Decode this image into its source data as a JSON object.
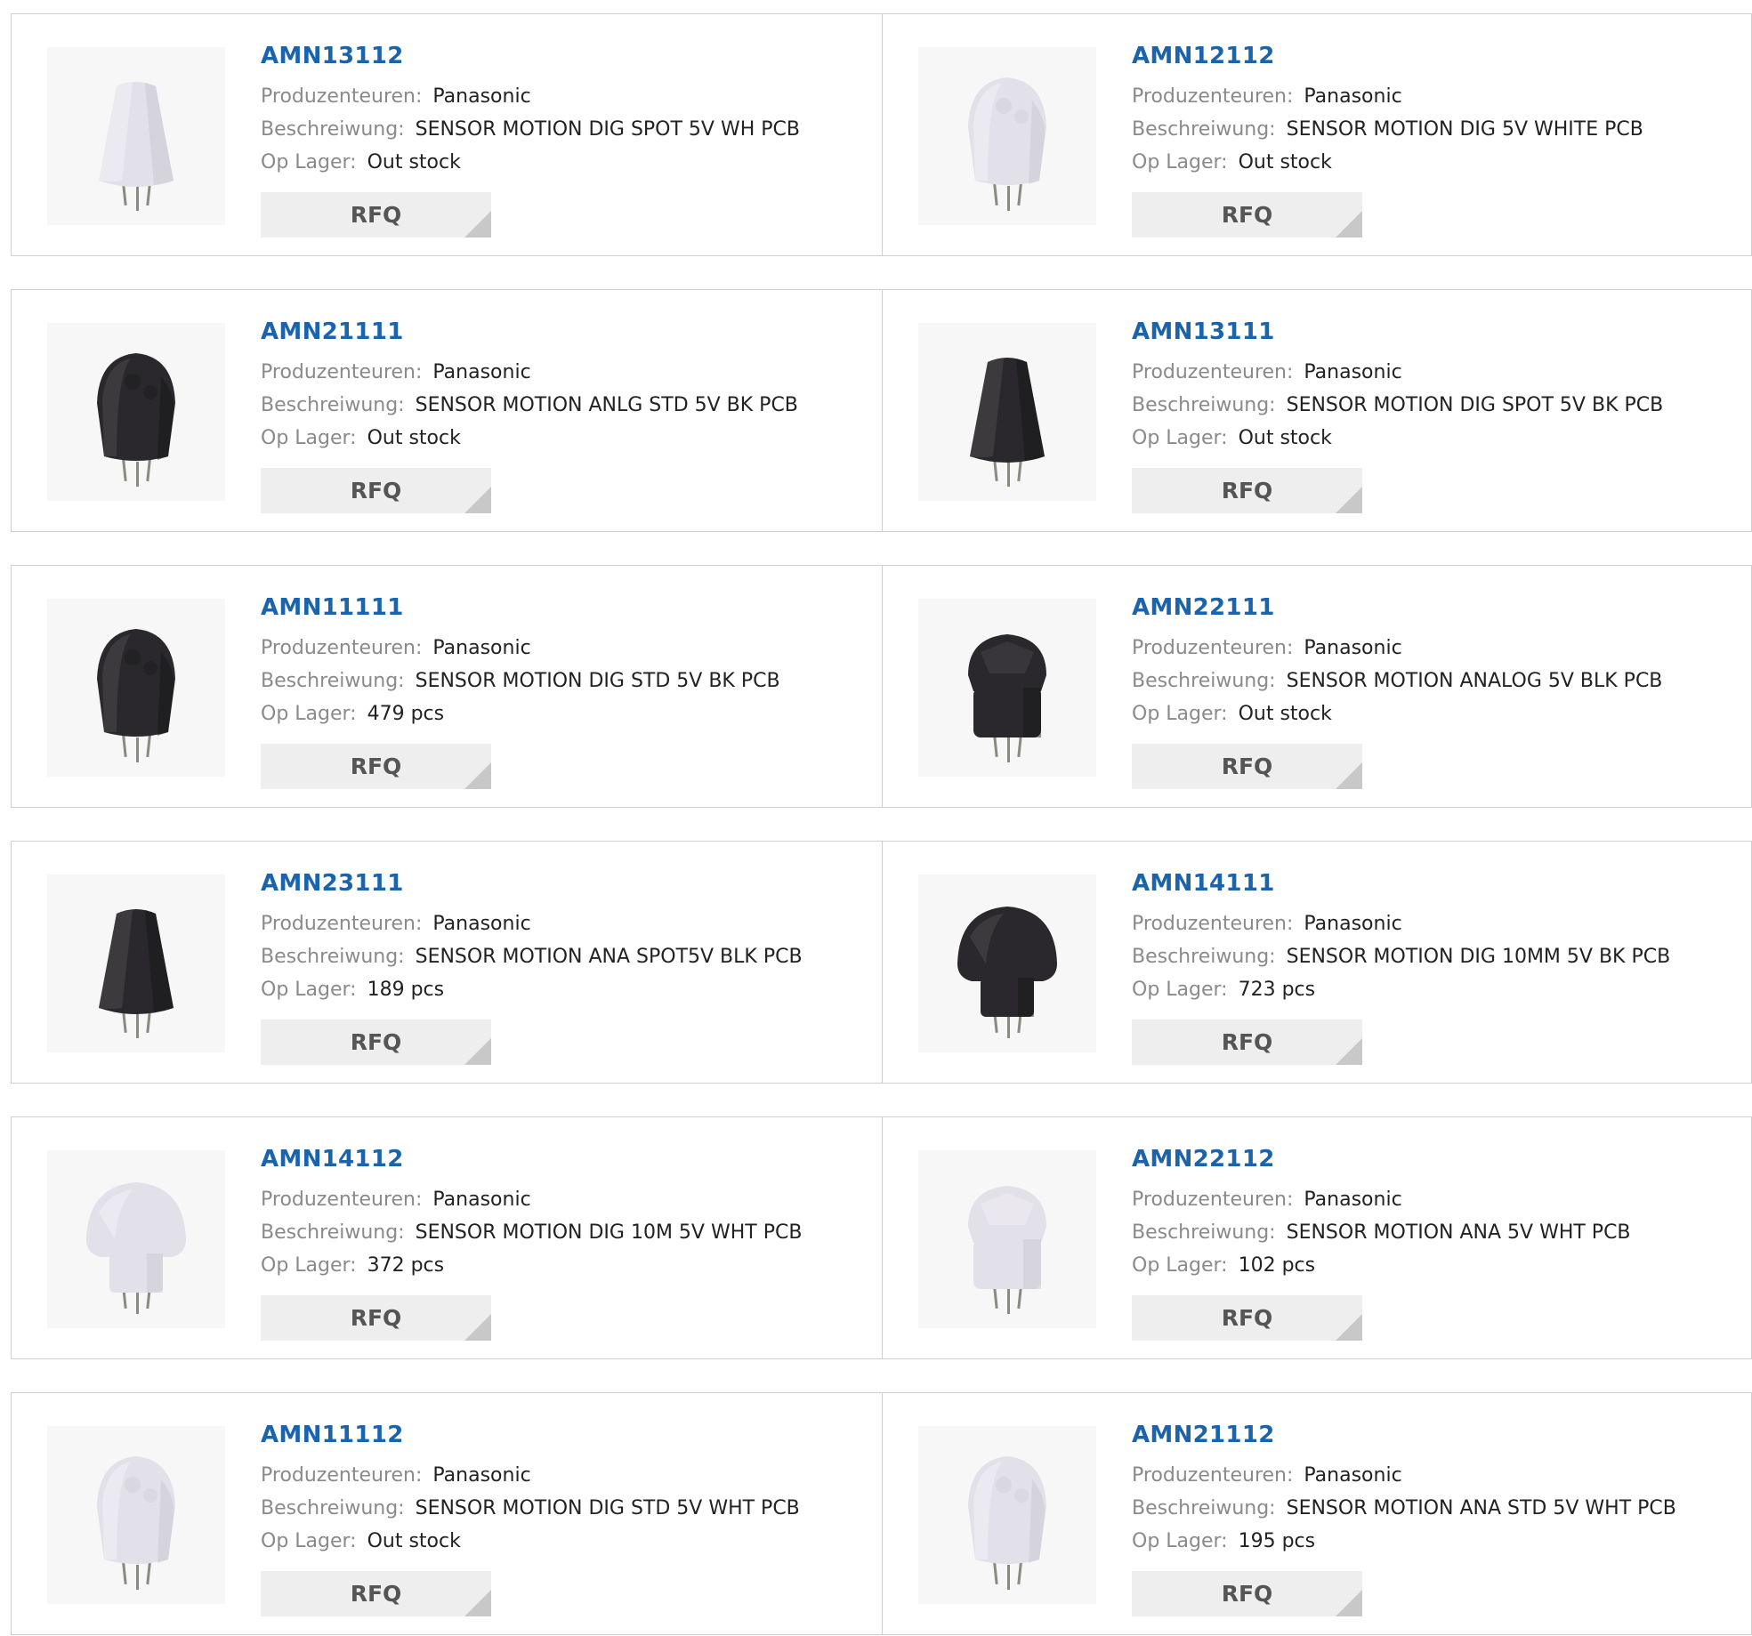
{
  "labels": {
    "manufacturer": "Produzenteuren:",
    "description": "Beschreiwung:",
    "stock": "Op Lager:",
    "rfq": "RFQ"
  },
  "colors": {
    "part_number": "#1a63ad",
    "label": "#8a8a8a",
    "value": "#222222",
    "rfq_bg": "#eeeeee"
  },
  "products": [
    {
      "pn": "AMN13112",
      "manufacturer": "Panasonic",
      "description": "SENSOR MOTION DIG SPOT 5V WH PCB",
      "stock": "Out stock",
      "image": "white-slim-sensor"
    },
    {
      "pn": "AMN12112",
      "manufacturer": "Panasonic",
      "description": "SENSOR MOTION DIG 5V WHITE PCB",
      "stock": "Out stock",
      "image": "white-dome-sensor"
    },
    {
      "pn": "AMN21111",
      "manufacturer": "Panasonic",
      "description": "SENSOR MOTION ANLG STD 5V BK PCB",
      "stock": "Out stock",
      "image": "black-dome-sensor"
    },
    {
      "pn": "AMN13111",
      "manufacturer": "Panasonic",
      "description": "SENSOR MOTION DIG SPOT 5V BK PCB",
      "stock": "Out stock",
      "image": "black-slim-sensor"
    },
    {
      "pn": "AMN11111",
      "manufacturer": "Panasonic",
      "description": "SENSOR MOTION DIG STD 5V BK PCB",
      "stock": "479 pcs",
      "image": "black-dome-sensor"
    },
    {
      "pn": "AMN22111",
      "manufacturer": "Panasonic",
      "description": "SENSOR MOTION ANALOG 5V BLK PCB",
      "stock": "Out stock",
      "image": "black-faceted-sensor"
    },
    {
      "pn": "AMN23111",
      "manufacturer": "Panasonic",
      "description": "SENSOR MOTION ANA SPOT5V BLK PCB",
      "stock": "189 pcs",
      "image": "black-slim-sensor"
    },
    {
      "pn": "AMN14111",
      "manufacturer": "Panasonic",
      "description": "SENSOR MOTION DIG 10MM 5V BK PCB",
      "stock": "723 pcs",
      "image": "black-wide-dome-sensor"
    },
    {
      "pn": "AMN14112",
      "manufacturer": "Panasonic",
      "description": "SENSOR MOTION DIG 10M 5V WHT PCB",
      "stock": "372 pcs",
      "image": "white-wide-dome-sensor"
    },
    {
      "pn": "AMN22112",
      "manufacturer": "Panasonic",
      "description": "SENSOR MOTION ANA 5V WHT PCB",
      "stock": "102 pcs",
      "image": "white-faceted-sensor"
    },
    {
      "pn": "AMN11112",
      "manufacturer": "Panasonic",
      "description": "SENSOR MOTION DIG STD 5V WHT PCB",
      "stock": "Out stock",
      "image": "white-dome-sensor"
    },
    {
      "pn": "AMN21112",
      "manufacturer": "Panasonic",
      "description": "SENSOR MOTION ANA STD 5V WHT PCB",
      "stock": "195 pcs",
      "image": "white-dome-sensor"
    }
  ]
}
